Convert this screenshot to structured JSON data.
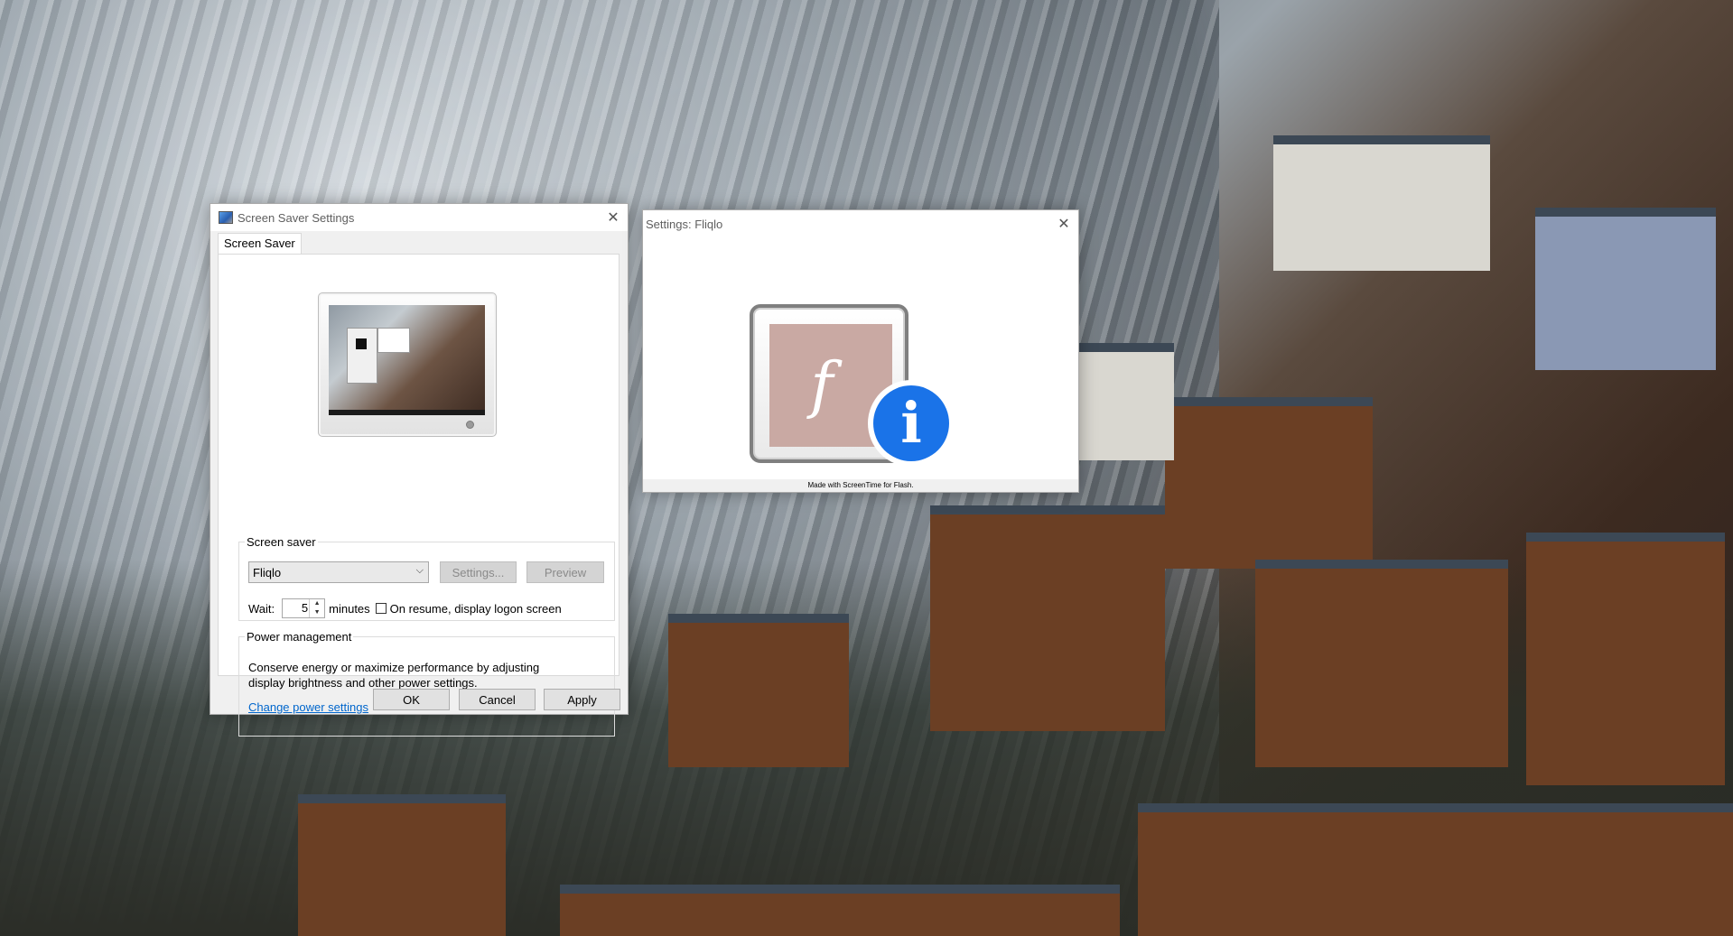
{
  "screen_saver_window": {
    "title": "Screen Saver Settings",
    "close_glyph": "✕",
    "tab_label": "Screen Saver",
    "screen_saver_group": {
      "legend": "Screen saver",
      "selected": "Fliqlo",
      "settings_label": "Settings...",
      "preview_label": "Preview",
      "wait_label": "Wait:",
      "wait_value": "5",
      "minutes_label": "minutes",
      "resume_label": "On resume, display logon screen",
      "resume_checked": false
    },
    "power_group": {
      "legend": "Power management",
      "description": "Conserve energy or maximize performance by adjusting display brightness and other power settings.",
      "link": "Change power settings"
    },
    "buttons": {
      "ok": "OK",
      "cancel": "Cancel",
      "apply": "Apply"
    }
  },
  "fliqlo_window": {
    "title": "Settings: Fliqlo",
    "close_glyph": "✕",
    "plugin_icon": "flash-plugin-info-icon",
    "status_text": "Made with ScreenTime for Flash."
  },
  "icons": {
    "chevron": "⌵",
    "spin_up": "▲",
    "spin_down": "▼",
    "flash_glyph": "f",
    "info_glyph": "i"
  },
  "colors": {
    "accent_blue": "#1a73e8",
    "link_blue": "#0066cc",
    "flash_bg": "#c9a9a3"
  }
}
